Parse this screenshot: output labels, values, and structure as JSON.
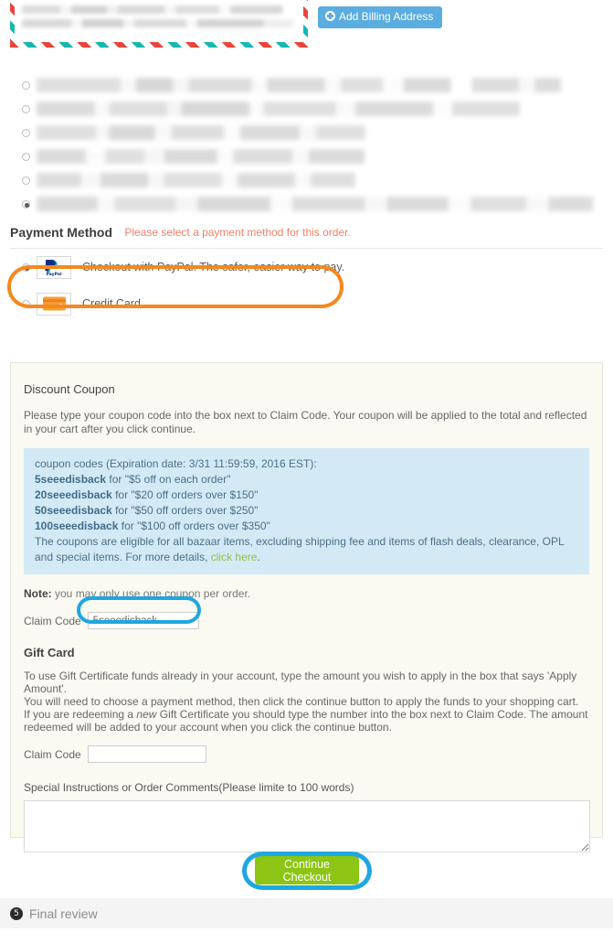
{
  "billing": {
    "add_button_label": "Add Billing Address",
    "add_button_icon": "plus-circle-icon",
    "address_redacted": true,
    "address_lines": [
      "",
      ""
    ]
  },
  "shipping_options": {
    "count": 6,
    "selected_index": 5,
    "items": [
      {
        "redacted": true,
        "label": ""
      },
      {
        "redacted": true,
        "label": ""
      },
      {
        "redacted": true,
        "label": ""
      },
      {
        "redacted": true,
        "label": ""
      },
      {
        "redacted": true,
        "label": ""
      },
      {
        "redacted": true,
        "label": ""
      }
    ]
  },
  "payment_method": {
    "title": "Payment Method",
    "hint": "Please select a payment method for this order.",
    "hint_color": "#f0806a",
    "options": [
      {
        "id": "paypal",
        "icon": "paypal-logo-icon",
        "label": "Checkout with PayPal. The safer, easier way to pay.",
        "selected": true
      },
      {
        "id": "credit-card",
        "icon": "credit-card-icon",
        "label": "Credit Card",
        "selected": false
      }
    ]
  },
  "discount": {
    "title": "Discount Coupon",
    "description": "Please type your coupon code into the box next to Claim Code. Your coupon will be applied to the total and reflected in your cart after you click continue.",
    "info": {
      "heading": "coupon codes (Expiration date: 3/31 11:59:59, 2016 EST):",
      "codes": [
        {
          "code": "5seeedisback",
          "desc": "for \"$5 off on each order\""
        },
        {
          "code": "20seeedisback",
          "desc": "for \"$20 off orders over $150\""
        },
        {
          "code": "50seeedisback",
          "desc": "for \"$50 off orders over $250\""
        },
        {
          "code": "100seeedisback",
          "desc": "for \"$100 off orders over $350\""
        }
      ],
      "footer_text": "The coupons are eligible for all bazaar items, excluding shipping fee and items of flash deals, clearance, OPL and special items. For more details, ",
      "footer_link": "click here",
      "footer_end": ".",
      "background_color": "#d3e9f5",
      "link_color": "#8fc23e"
    },
    "note_label": "Note:",
    "note_text": " you may only use one coupon per order.",
    "claim_code_label": "Claim Code",
    "claim_code_value": "5seeedisback",
    "claim_code_placeholder": ""
  },
  "gift_card": {
    "title": "Gift Card",
    "paragraph_1": "To use Gift Certificate funds already in your account, type the amount you wish to apply in the box that says 'Apply Amount'.",
    "paragraph_2": "You will need to choose a payment method, then click the continue button to apply the funds to your shopping cart.",
    "paragraph_3_a": "If you are redeeming a ",
    "paragraph_3_em": "new",
    "paragraph_3_b": " Gift Certificate you should type the number into the box next to Claim Code. The amount redeemed will be added to your account when you click the continue button.",
    "claim_code_label": "Claim Code",
    "claim_code_value": "",
    "claim_code_placeholder": ""
  },
  "special_instructions": {
    "label": "Special Instructions or Order Comments(Please limite to 100 words)",
    "value": "",
    "placeholder": ""
  },
  "continue": {
    "label": "Continue Checkout",
    "color": "#8cc514"
  },
  "final_review": {
    "step_number": "5",
    "label": "Final review"
  },
  "annotations": {
    "paypal_highlight_color": "#f5881f",
    "claim_code_highlight_color": "#1ea7e1",
    "continue_highlight_color": "#1ea7e1"
  }
}
